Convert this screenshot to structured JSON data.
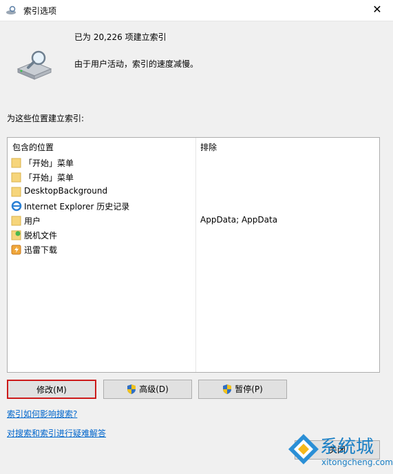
{
  "window": {
    "title": "索引选项",
    "close_glyph": "✕"
  },
  "status": {
    "count_text": "已为 20,226 项建立索引",
    "speed_text": "由于用户活动，索引的速度减慢。"
  },
  "locations": {
    "label": "为这些位置建立索引:",
    "header_included": "包含的位置",
    "header_excluded": "排除",
    "rows": [
      {
        "name": "「开始」菜单",
        "icon": "folder-icon",
        "excluded": ""
      },
      {
        "name": "「开始」菜单",
        "icon": "folder-icon",
        "excluded": ""
      },
      {
        "name": "DesktopBackground",
        "icon": "folder-icon",
        "excluded": ""
      },
      {
        "name": "Internet Explorer 历史记录",
        "icon": "internet-explorer-icon",
        "excluded": ""
      },
      {
        "name": "用户",
        "icon": "folder-icon",
        "excluded": "AppData; AppData"
      },
      {
        "name": "脱机文件",
        "icon": "offline-files-icon",
        "excluded": ""
      },
      {
        "name": "迅雷下载",
        "icon": "thunder-download-icon",
        "excluded": ""
      }
    ]
  },
  "buttons": {
    "modify": "修改(M)",
    "advanced": "高级(D)",
    "pause": "暂停(P)",
    "close": "关闭"
  },
  "links": {
    "how_affects": "索引如何影响搜索?",
    "troubleshoot": "对搜索和索引进行疑难解答"
  },
  "watermark": {
    "brand": "系统城",
    "url": "xitongcheng.com"
  },
  "colors": {
    "link": "#0066cc",
    "focus_border": "#cc1a1a",
    "watermark": "#1a7fc5"
  }
}
